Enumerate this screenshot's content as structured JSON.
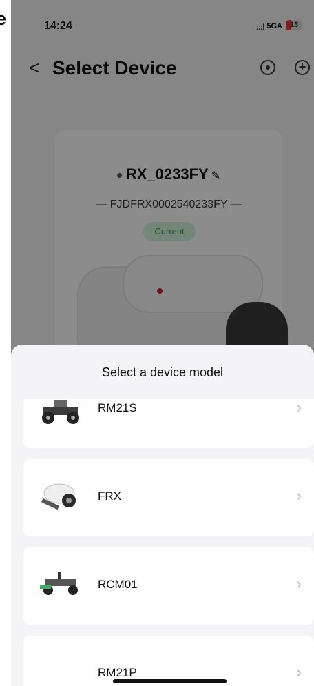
{
  "fragment_text": "e",
  "status_bar": {
    "time": "14:24",
    "signal": ":::!",
    "network": "5GA",
    "battery": "13"
  },
  "header": {
    "back_icon": "chevron-left",
    "title": "Select Device",
    "locate_icon": "crosshair",
    "add_icon": "plus-circle"
  },
  "device_card": {
    "name": "RX_0233FY",
    "serial": "— FJDFRX0002540233FY —",
    "badge": "Current"
  },
  "sheet": {
    "title": "Select a device model",
    "items": [
      {
        "label": "RM21S"
      },
      {
        "label": "FRX"
      },
      {
        "label": "RCM01"
      },
      {
        "label": "RM21P"
      }
    ]
  },
  "colors": {
    "badge_bg": "#d8f3dc",
    "badge_text": "#2e9a48",
    "battery_low": "#e53935"
  }
}
